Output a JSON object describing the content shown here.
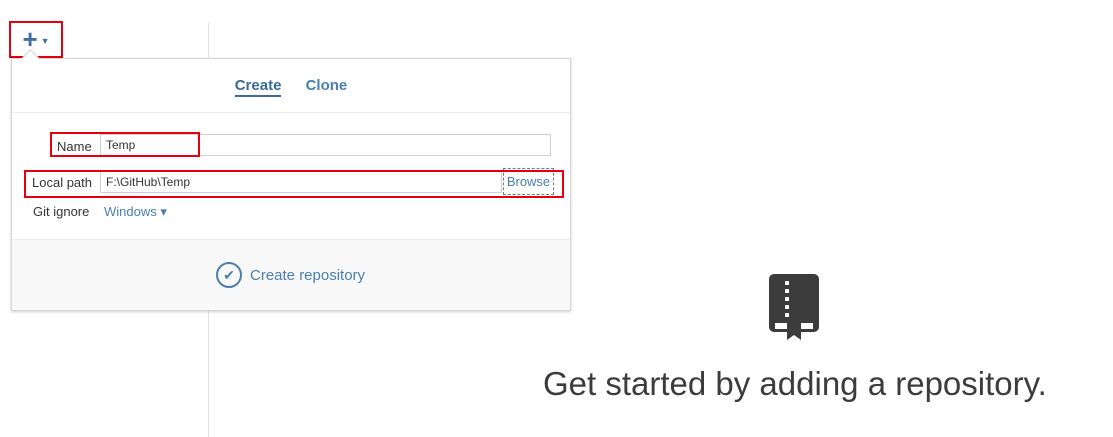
{
  "toolbar": {
    "add_icon": "plus-icon",
    "caret_icon": "caret-down-icon"
  },
  "popup": {
    "tabs": [
      {
        "label": "Create",
        "active": true
      },
      {
        "label": "Clone",
        "active": false
      }
    ],
    "name": {
      "label": "Name",
      "value": "Temp"
    },
    "local_path": {
      "label": "Local path",
      "value": "F:\\GitHub\\Temp",
      "browse_label": "Browse"
    },
    "git_ignore": {
      "label": "Git ignore",
      "value": "Windows ▾"
    },
    "create_button_label": "Create repository"
  },
  "empty_state": {
    "icon": "repo-book-icon",
    "message": "Get started by adding a repository."
  },
  "colors": {
    "accent": "#4a7fb0",
    "highlight": "#e3000f"
  }
}
